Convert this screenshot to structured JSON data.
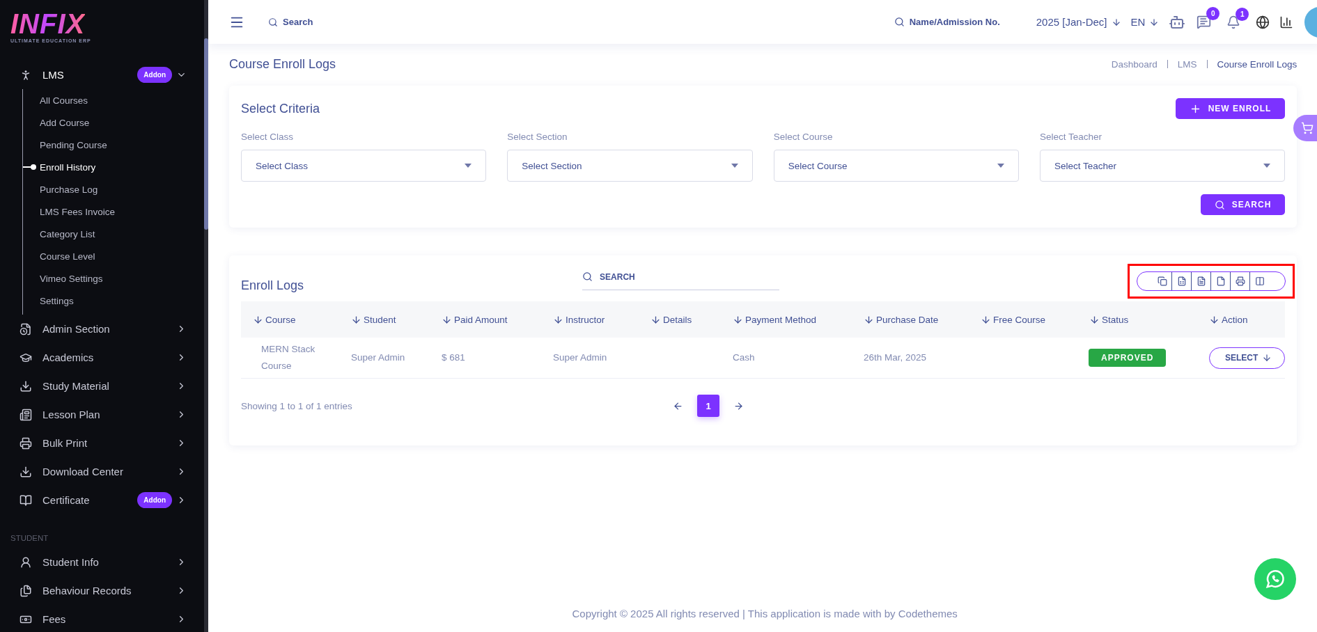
{
  "sidebar": {
    "logo": {
      "wordmark": "INFIX",
      "tagline": "ULTIMATE EDUCATION ERP"
    },
    "groups": [
      {
        "items": [
          {
            "label": "LMS",
            "badge": "Addon",
            "expanded": true,
            "children": [
              {
                "label": "All Courses",
                "selected": false
              },
              {
                "label": "Add Course",
                "selected": false
              },
              {
                "label": "Pending Course",
                "selected": false
              },
              {
                "label": "Enroll History",
                "selected": true
              },
              {
                "label": "Purchase Log",
                "selected": false
              },
              {
                "label": "LMS Fees Invoice",
                "selected": false
              },
              {
                "label": "Category List",
                "selected": false
              },
              {
                "label": "Course Level",
                "selected": false
              },
              {
                "label": "Vimeo Settings",
                "selected": false
              },
              {
                "label": "Settings",
                "selected": false
              }
            ]
          },
          {
            "label": "Admin Section",
            "expanded": false
          },
          {
            "label": "Academics",
            "expanded": false
          },
          {
            "label": "Study Material",
            "expanded": false
          },
          {
            "label": "Lesson Plan",
            "expanded": false
          },
          {
            "label": "Bulk Print",
            "expanded": false
          },
          {
            "label": "Download Center",
            "expanded": false
          },
          {
            "label": "Certificate",
            "badge": "Addon",
            "expanded": false
          }
        ]
      },
      {
        "heading": "STUDENT",
        "items": [
          {
            "label": "Student Info",
            "expanded": false
          },
          {
            "label": "Behaviour Records",
            "expanded": false
          },
          {
            "label": "Fees",
            "expanded": false
          }
        ]
      }
    ]
  },
  "header": {
    "search_placeholder": "Search",
    "student_search_placeholder": "Name/Admission No.",
    "session": "2025 [Jan-Dec]",
    "language": "EN",
    "messages_count": "0",
    "notifications_count": "1"
  },
  "page": {
    "title": "Course Enroll Logs",
    "breadcrumbs": [
      {
        "label": "Dashboard",
        "current": false
      },
      {
        "label": "LMS",
        "current": false
      },
      {
        "label": "Course Enroll Logs",
        "current": true
      }
    ]
  },
  "criteria": {
    "title": "Select Criteria",
    "new_button": "NEW ENROLL",
    "fields": [
      {
        "label": "Select Class",
        "placeholder": "Select Class"
      },
      {
        "label": "Select Section",
        "placeholder": "Select Section"
      },
      {
        "label": "Select Course",
        "placeholder": "Select Course"
      },
      {
        "label": "Select Teacher",
        "placeholder": "Select Teacher"
      }
    ],
    "search_button": "SEARCH"
  },
  "enroll_logs": {
    "title": "Enroll Logs",
    "search_placeholder": "SEARCH",
    "columns": [
      "Course",
      "Student",
      "Paid Amount",
      "Instructor",
      "Details",
      "Payment Method",
      "Purchase Date",
      "Free Course",
      "Status",
      "Action"
    ],
    "rows": [
      {
        "cells": [
          "MERN Stack Course",
          "Super Admin",
          "$ 681",
          "Super Admin",
          null,
          "Cash",
          "26th Mar, 2025",
          null
        ],
        "status": "APPROVED",
        "action": "SELECT"
      }
    ],
    "info": "Showing 1 to 1 of 1 entries",
    "pages": [
      {
        "label": "1",
        "selected": true
      }
    ]
  },
  "footer": "Copyright © 2025 All rights reserved | This application is made with by Codethemes"
}
